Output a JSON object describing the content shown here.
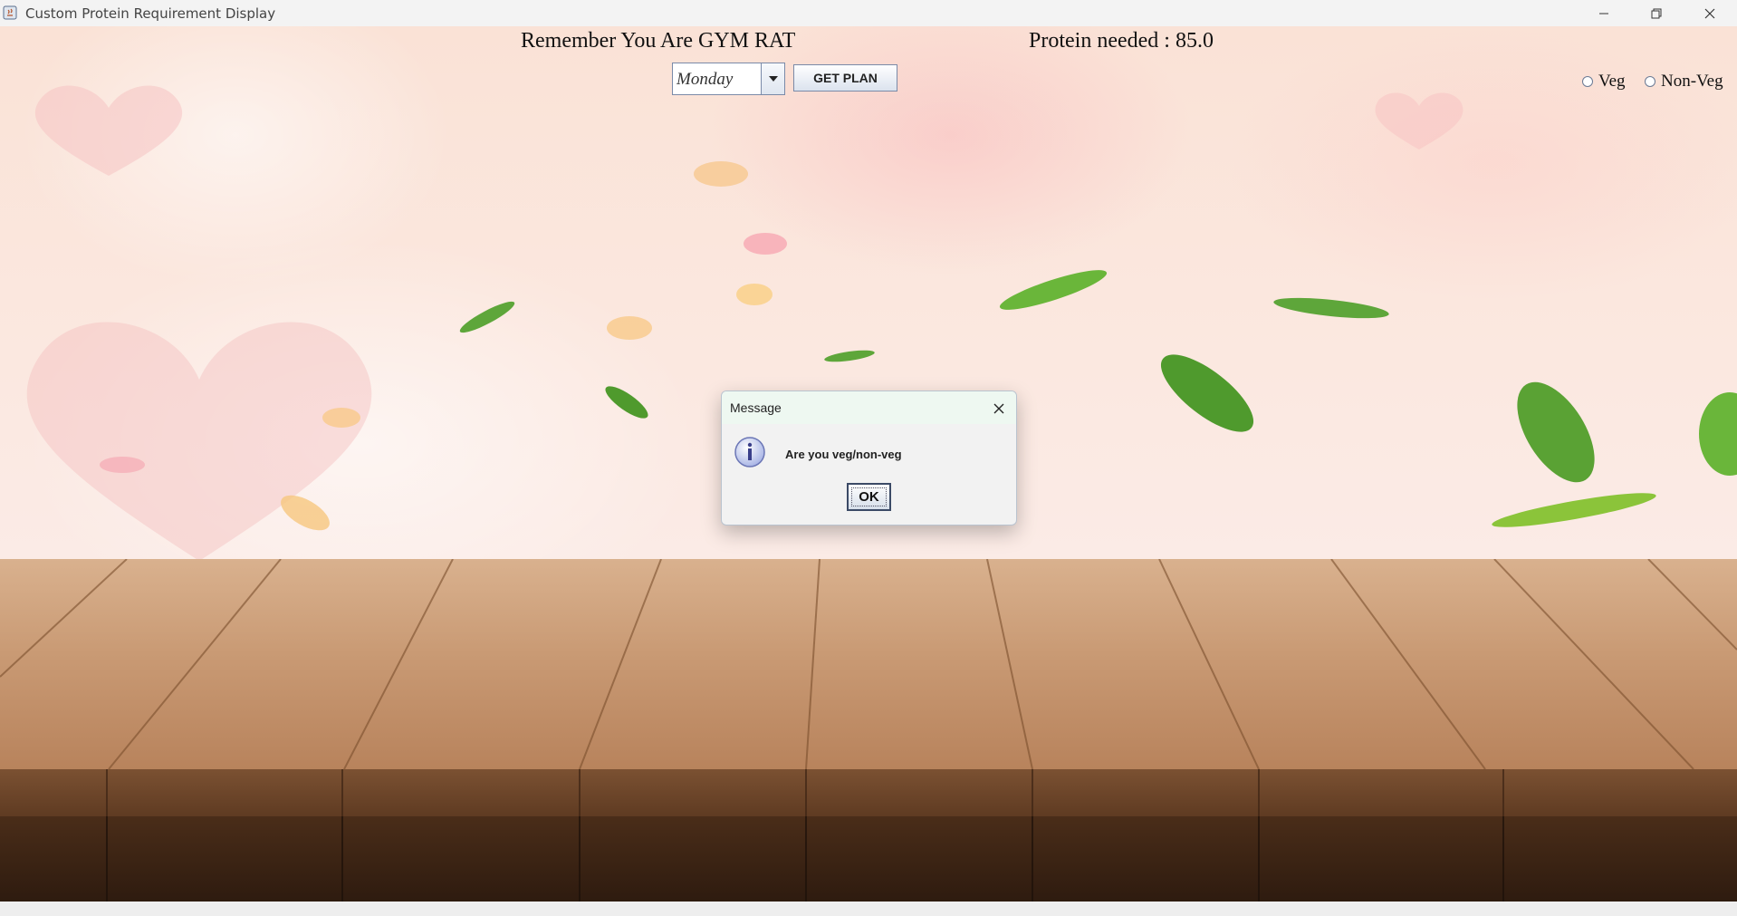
{
  "window": {
    "title": "Custom Protein Requirement Display",
    "icons": {
      "app": "java-app-icon",
      "minimize": "minimize-icon",
      "restore": "restore-icon",
      "close": "close-icon"
    }
  },
  "header": {
    "motto": "Remember You Are GYM RAT",
    "protein_needed": "Protein needed : 85.0"
  },
  "controls": {
    "day_select_value": "Monday",
    "get_plan_label": "GET PLAN",
    "diet_options": [
      {
        "label": "Veg",
        "selected": false
      },
      {
        "label": "Non-Veg",
        "selected": false
      }
    ]
  },
  "dialog": {
    "title": "Message",
    "message": "Are you veg/non-veg",
    "ok_label": "OK",
    "icon": "info-icon"
  },
  "colors": {
    "titlebar": "#f3f3f3",
    "dialog_header": "#eef8f1",
    "button_border": "#7a8aa8"
  }
}
